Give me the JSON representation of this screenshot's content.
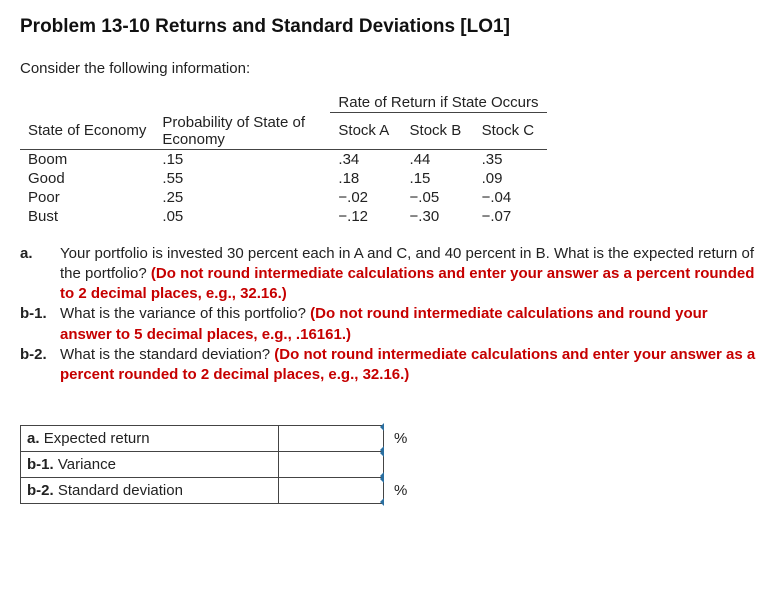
{
  "title": "Problem 13-10 Returns and Standard Deviations [LO1]",
  "intro": "Consider the following information:",
  "table": {
    "rate_header": "Rate of Return if State Occurs",
    "col_state": "State of Economy",
    "col_prob": "Probability of State of Economy",
    "col_a": "Stock A",
    "col_b": "Stock B",
    "col_c": "Stock C",
    "rows": [
      {
        "state": "Boom",
        "prob": ".15",
        "a": ".34",
        "b": ".44",
        "c": ".35"
      },
      {
        "state": "Good",
        "prob": ".55",
        "a": ".18",
        "b": ".15",
        "c": ".09"
      },
      {
        "state": "Poor",
        "prob": ".25",
        "a": "−.02",
        "b": "−.05",
        "c": "−.04"
      },
      {
        "state": "Bust",
        "prob": ".05",
        "a": "−.12",
        "b": "−.30",
        "c": "−.07"
      }
    ]
  },
  "questions": {
    "a": {
      "label": "a.",
      "text": "Your portfolio is invested 30 percent each in A and C, and 40 percent in B. What is the expected return of the portfolio? ",
      "emph": "(Do not round intermediate calculations and enter your answer as a percent rounded to 2 decimal places, e.g., 32.16.)"
    },
    "b1": {
      "label": "b-1.",
      "text": "What is the variance of this portfolio? ",
      "emph": "(Do not round intermediate calculations and round your answer to 5 decimal places, e.g., .16161.)"
    },
    "b2": {
      "label": "b-2.",
      "text": "What is the standard deviation? ",
      "emph": "(Do not round intermediate calculations and enter your answer as a percent rounded to 2 decimal places, e.g., 32.16.)"
    }
  },
  "answers": {
    "a": {
      "pre": "a.",
      "label": "Expected return",
      "unit": "%"
    },
    "b1": {
      "pre": "b-1.",
      "label": "Variance",
      "unit": ""
    },
    "b2": {
      "pre": "b-2.",
      "label": "Standard deviation",
      "unit": "%"
    }
  }
}
